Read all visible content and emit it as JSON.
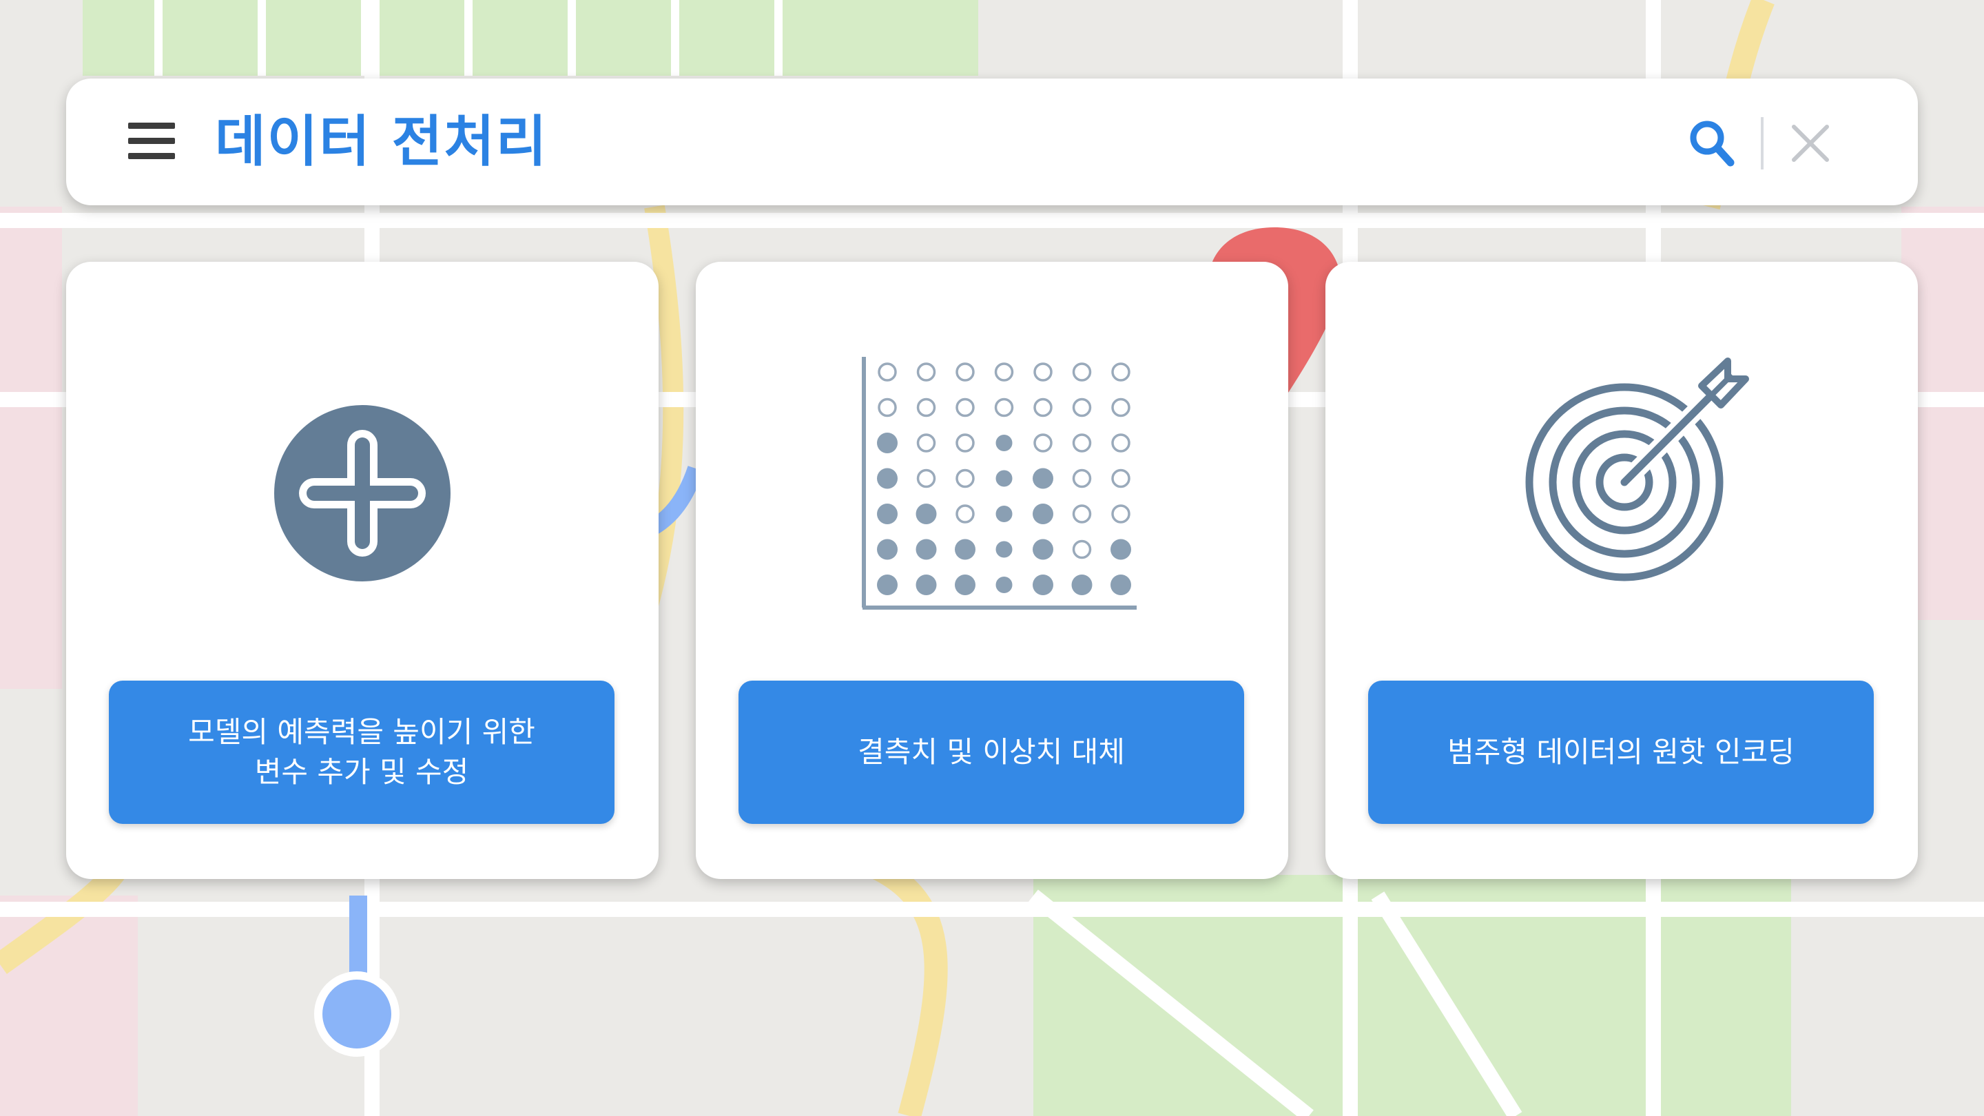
{
  "search": {
    "title": "데이터 전처리"
  },
  "icons": {
    "menu": "hamburger-menu-icon",
    "search": "search-icon",
    "close": "close-icon"
  },
  "cards": [
    {
      "icon": "plus-circle-icon",
      "label": "모델의 예측력을 높이기 위한\n변수 추가 및 수정"
    },
    {
      "icon": "dot-matrix-chart-icon",
      "label": "결측치 및 이상치 대체"
    },
    {
      "icon": "target-arrow-icon",
      "label": "범주형 데이터의 원핫 인코딩"
    }
  ],
  "colors": {
    "accent": "#2b82e3",
    "button": "#3489e6",
    "icon": "#637d96",
    "map_background": "#ebeae7",
    "map_park": "#d6ecc6",
    "map_road_major": "#f6e3a0",
    "map_pin": "#e96b6b",
    "map_location": "#8ab4f8"
  }
}
